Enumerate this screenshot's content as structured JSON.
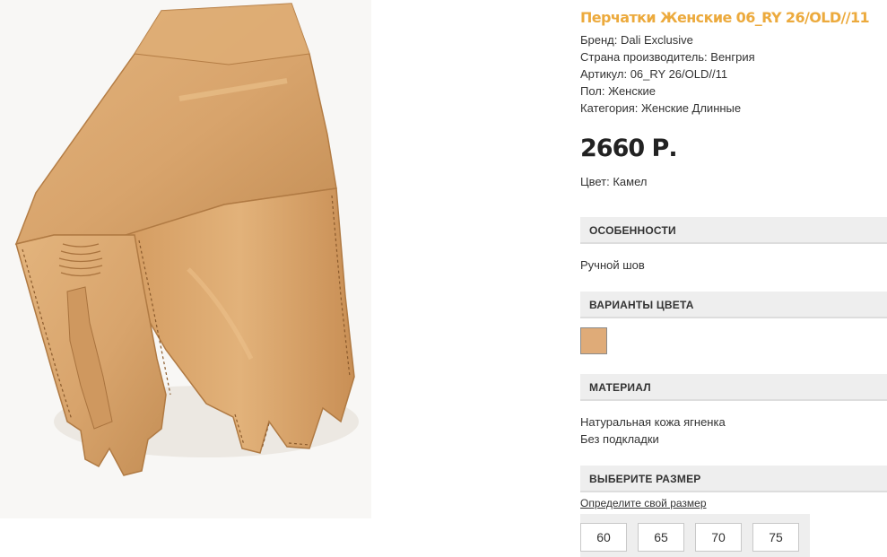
{
  "product": {
    "title": "Перчатки Женские 06_RY 26/OLD//11",
    "brand": "Бренд: Dali Exclusive",
    "country": "Страна производитель: Венгрия",
    "article": "Артикул: 06_RY 26/OLD//11",
    "gender": "Пол: Женские",
    "category": "Категория: Женские Длинные",
    "price": "2660 Р.",
    "color": "Цвет: Камел"
  },
  "sections": {
    "features": {
      "header": "ОСОБЕННОСТИ",
      "text": "Ручной шов"
    },
    "color_variants": {
      "header": "ВАРИАНТЫ ЦВЕТА",
      "swatch_color": "#dfab78"
    },
    "material": {
      "header": "МАТЕРИАЛ",
      "lines": [
        "Натуральная кожа ягненка",
        "Без подкладки"
      ]
    },
    "size": {
      "header": "ВЫБЕРИТЕ РАЗМЕР",
      "link": "Определите свой размер",
      "options": [
        "60",
        "65",
        "70",
        "75"
      ]
    }
  },
  "colors": {
    "title": "#ecaa3d",
    "leather": "#d8a46c"
  },
  "photo": {
    "subject": "glove-photo"
  }
}
